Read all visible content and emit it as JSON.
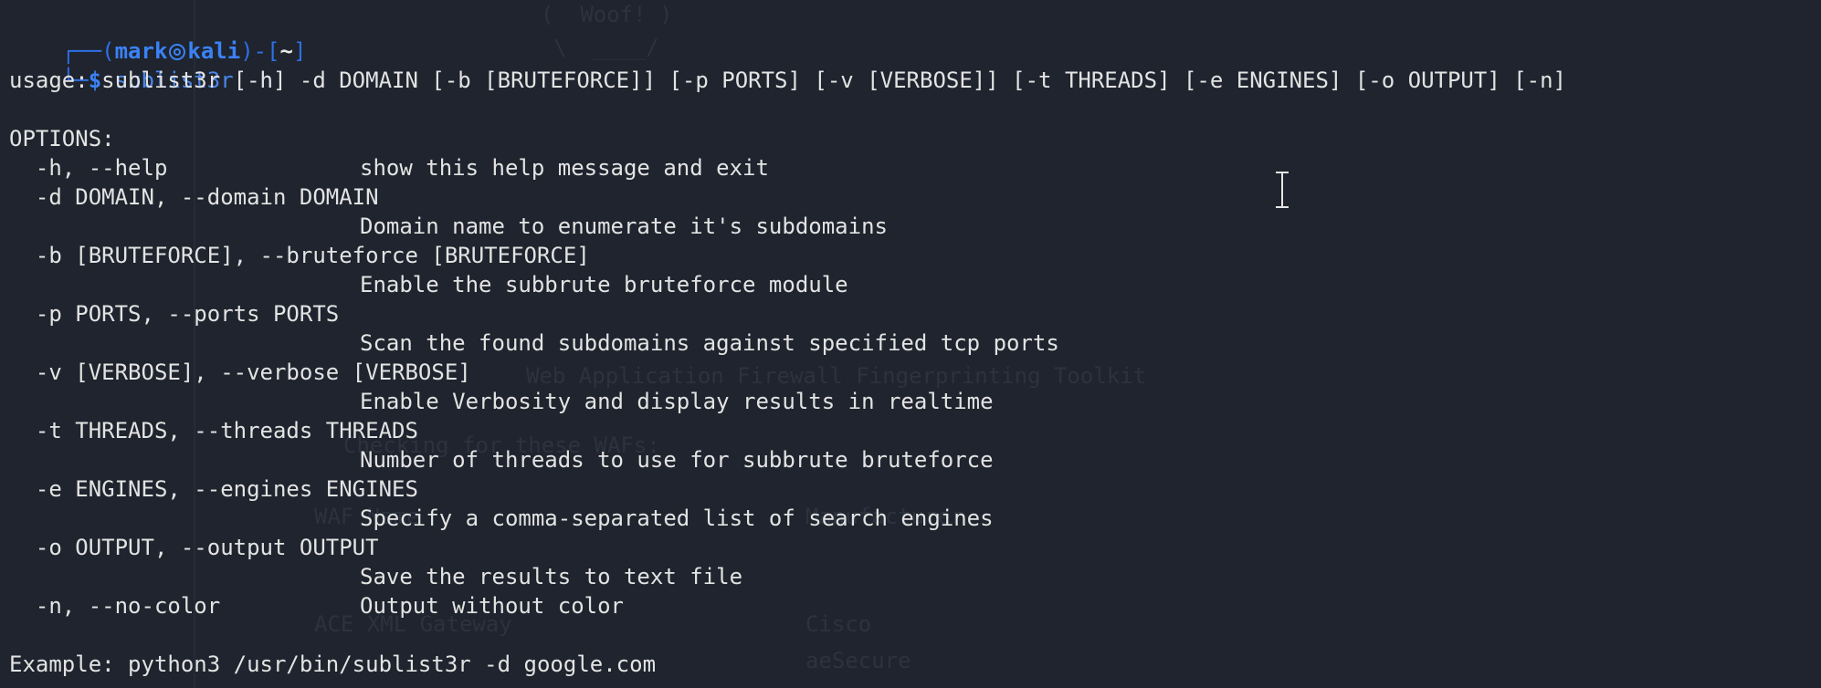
{
  "window": {
    "background": "#1f242e",
    "text_color": "#e3e3e3",
    "accent_color": "#3b82f6"
  },
  "prompt": {
    "box_top_left": "┌──(",
    "user": "mark",
    "host": "kali",
    "box_mid": ")-[",
    "path": "~",
    "box_end": "]",
    "box_bottom_left": "└─",
    "dollar": "$",
    "command": " sublist3r -h"
  },
  "output": {
    "usage": "usage: sublist3r [-h] -d DOMAIN [-b [BRUTEFORCE]] [-p PORTS] [-v [VERBOSE]] [-t THREADS] [-e ENGINES] [-o OUTPUT] [-n]",
    "options_header": "OPTIONS:",
    "options": [
      {
        "flag": "  -h, --help",
        "desc_inline": "show this help message and exit"
      },
      {
        "flag": "  -d DOMAIN, --domain DOMAIN",
        "desc": "Domain name to enumerate it's subdomains"
      },
      {
        "flag": "  -b [BRUTEFORCE], --bruteforce [BRUTEFORCE]",
        "desc": "Enable the subbrute bruteforce module"
      },
      {
        "flag": "  -p PORTS, --ports PORTS",
        "desc": "Scan the found subdomains against specified tcp ports"
      },
      {
        "flag": "  -v [VERBOSE], --verbose [VERBOSE]",
        "desc": "Enable Verbosity and display results in realtime"
      },
      {
        "flag": "  -t THREADS, --threads THREADS",
        "desc": "Number of threads to use for subbrute bruteforce"
      },
      {
        "flag": "  -e ENGINES, --engines ENGINES",
        "desc": "Specify a comma-separated list of search engines"
      },
      {
        "flag": "  -o OUTPUT, --output OUTPUT",
        "desc": "Save the results to text file"
      },
      {
        "flag": "  -n, --no-color",
        "desc_inline": "Output without color"
      }
    ],
    "example": "Example: python3 /usr/bin/sublist3r -d google.com"
  },
  "ghost_background": {
    "lines": [
      "(  Woof! )",
      "\\  ____/",
      "Web Application Firewall Fingerprinting Toolkit",
      "Checking for these WAFs:",
      "WAF Name",
      "Manufacturer",
      "ACE XML Gateway",
      "Cisco",
      "aeSecure"
    ]
  }
}
